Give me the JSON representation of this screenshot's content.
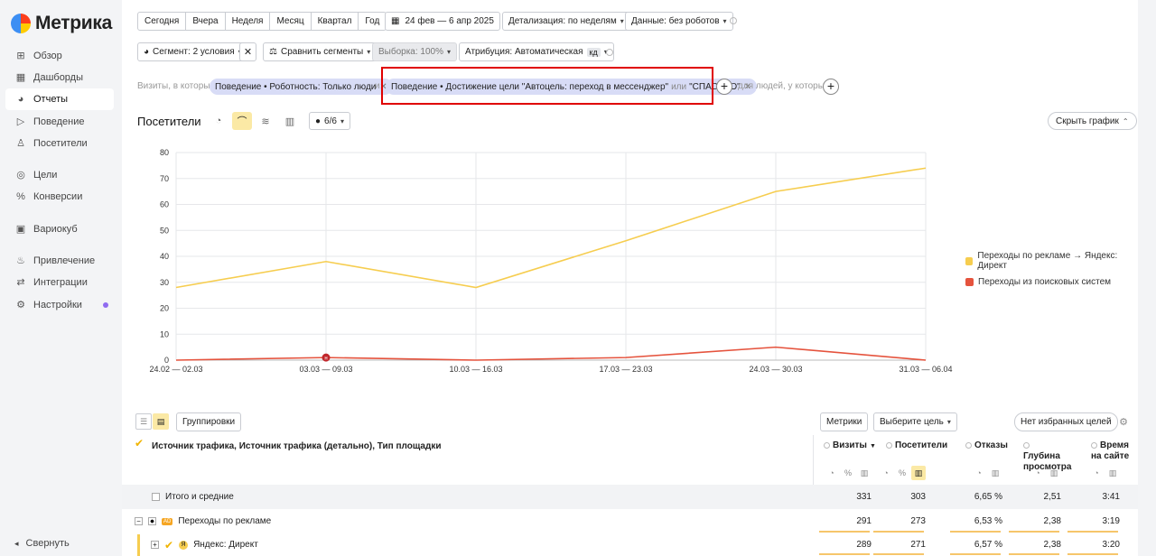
{
  "app": {
    "logo": "Метрика"
  },
  "sidebar": {
    "items": [
      {
        "label": "Обзор",
        "icon": "grid-icon",
        "glyph": "⊞"
      },
      {
        "label": "Дашборды",
        "icon": "dashboard-icon",
        "glyph": "▦"
      },
      {
        "label": "Отчеты",
        "icon": "reports-icon",
        "glyph": "◕"
      },
      {
        "label": "Поведение",
        "icon": "play-icon",
        "glyph": "▷"
      },
      {
        "label": "Посетители",
        "icon": "user-icon",
        "glyph": "♙"
      },
      {
        "label": "Цели",
        "icon": "target-icon",
        "glyph": "◎"
      },
      {
        "label": "Конверсии",
        "icon": "percent-icon",
        "glyph": "%"
      },
      {
        "label": "Вариокуб",
        "icon": "cube-icon",
        "glyph": "▣"
      },
      {
        "label": "Привлечение",
        "icon": "fire-icon",
        "glyph": "♨"
      },
      {
        "label": "Интеграции",
        "icon": "link-icon",
        "glyph": "⇄"
      },
      {
        "label": "Настройки",
        "icon": "gear-icon",
        "glyph": "⚙"
      }
    ],
    "collapse_label": "Свернуть"
  },
  "toolbar": {
    "periods": [
      "Сегодня",
      "Вчера",
      "Неделя",
      "Месяц",
      "Квартал",
      "Год"
    ],
    "date_range": "24 фев — 6 апр 2025",
    "detail": "Детализация: по неделям",
    "data": "Данные: без роботов",
    "segment": "Сегмент: 2 условия",
    "compare": "Сравнить сегменты",
    "sample": "Выборка: 100%",
    "attribution": "Атрибуция: Автоматическая",
    "attribution_badge": "кд"
  },
  "filters": {
    "prefix": "Визиты, в которых",
    "pill1": "Поведение • Роботность: Только люди",
    "and": "и",
    "pill2_main": "Поведение • Достижение цели \"Автоцель: переход в мессенджер\"",
    "pill2_or": "или",
    "pill2_tail": "\"СПАСИБО\"",
    "suffix": "для людей, у которых"
  },
  "chart": {
    "title": "Посетители",
    "series_count": "6/6",
    "hide_label": "Скрыть график"
  },
  "chart_data": {
    "type": "line",
    "categories": [
      "24.02 — 02.03",
      "03.03 — 09.03",
      "10.03 — 16.03",
      "17.03 — 23.03",
      "24.03 — 30.03",
      "31.03 — 06.04"
    ],
    "ylim": [
      0,
      80
    ],
    "yticks": [
      0,
      10,
      20,
      30,
      40,
      50,
      60,
      70,
      80
    ],
    "series": [
      {
        "name": "Переходы по рекламе → Яндекс: Директ",
        "color": "#f6cd4f",
        "values": [
          28,
          38,
          28,
          46,
          65,
          74
        ]
      },
      {
        "name": "Переходы из поисковых систем",
        "color": "#e5533d",
        "values": [
          0,
          1,
          0,
          1,
          5,
          0
        ]
      }
    ],
    "annotation": {
      "label": "н",
      "category_index": 1
    }
  },
  "table": {
    "toolbar": {
      "groupings": "Группировки",
      "metrics": "Метрики",
      "goal": "Выберите цель",
      "favorites": "Нет избранных целей"
    },
    "dimension_header": "Источник трафика, Источник трафика (детально), Тип площадки",
    "columns": [
      {
        "name": "Визиты",
        "sort": "▼"
      },
      {
        "name": "Посетители",
        "sort": ""
      },
      {
        "name": "Отказы",
        "sort": ""
      },
      {
        "name": "Глубина просмотра",
        "sort": ""
      },
      {
        "name": "Время на сайте",
        "sort": ""
      }
    ],
    "rows": [
      {
        "label": "Итого и средние",
        "values": [
          "331",
          "303",
          "6,65 %",
          "2,51",
          "3:41"
        ]
      },
      {
        "label": "Переходы по рекламе",
        "values": [
          "291",
          "273",
          "6,53 %",
          "2,38",
          "3:19"
        ]
      },
      {
        "label": "Яндекс: Директ",
        "values": [
          "289",
          "271",
          "6,57 %",
          "2,38",
          "3:20"
        ]
      }
    ]
  }
}
